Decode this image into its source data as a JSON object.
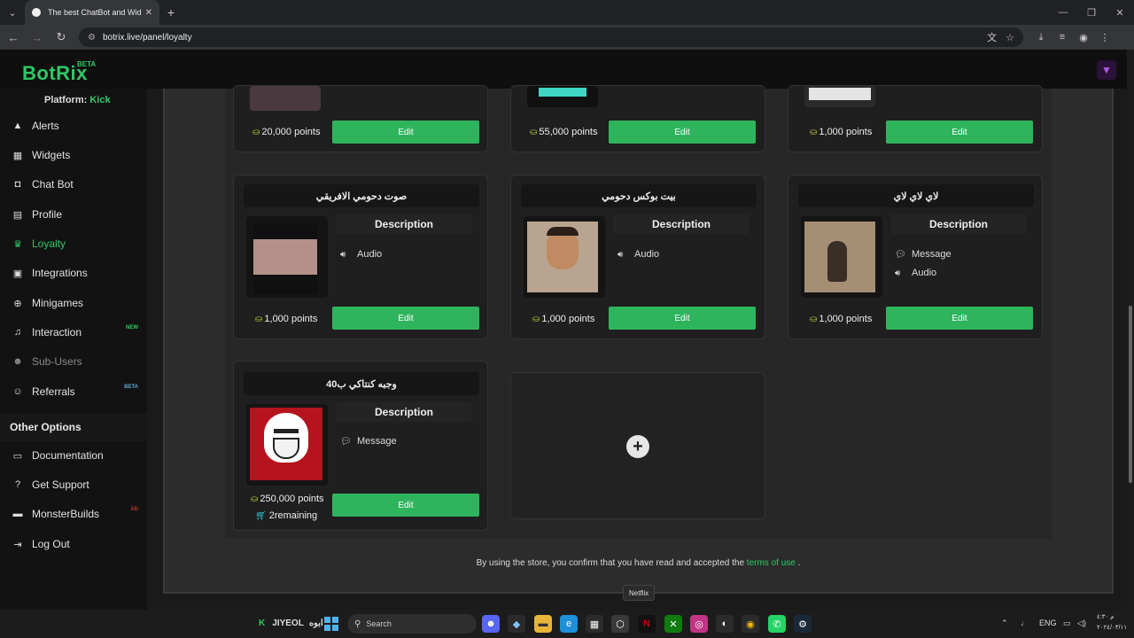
{
  "browser": {
    "tab_title": "The best ChatBot and Widgets",
    "tab_close": "✕",
    "new_tab": "+",
    "url": "botrix.live/panel/loyalty"
  },
  "app": {
    "brand": "BotRix",
    "brand_badge": "BETA",
    "platform_label": "Platform:",
    "platform_value": "Kick"
  },
  "sidebar": {
    "items": [
      {
        "label": "Alerts",
        "icon": "warning-icon"
      },
      {
        "label": "Widgets",
        "icon": "grid-icon"
      },
      {
        "label": "Chat Bot",
        "icon": "robot-icon"
      },
      {
        "label": "Profile",
        "icon": "id-card-icon"
      },
      {
        "label": "Loyalty",
        "icon": "trophy-icon"
      },
      {
        "label": "Integrations",
        "icon": "integrations-icon"
      },
      {
        "label": "Minigames",
        "icon": "gamepad-icon"
      },
      {
        "label": "Interaction",
        "icon": "music-icon",
        "badge": "NEW"
      },
      {
        "label": "Sub-Users",
        "icon": "users-icon"
      },
      {
        "label": "Referrals",
        "icon": "referrals-icon",
        "badge": "BETA"
      }
    ],
    "other_heading": "Other Options",
    "other_items": [
      {
        "label": "Documentation",
        "icon": "book-icon"
      },
      {
        "label": "Get Support",
        "icon": "question-icon"
      },
      {
        "label": "MonsterBuilds",
        "icon": "laptop-icon",
        "badge": "AD"
      },
      {
        "label": "Log Out",
        "icon": "logout-icon"
      }
    ]
  },
  "rewards_top": [
    {
      "points": "20,000 points",
      "edit": "Edit"
    },
    {
      "points": "55,000 points",
      "edit": "Edit"
    },
    {
      "points": "1,000 points",
      "edit": "Edit"
    }
  ],
  "rewards": [
    {
      "title": "صوت دحومي الافريقي",
      "desc": "Description",
      "features": [
        "Audio"
      ],
      "points": "1,000 points",
      "edit": "Edit"
    },
    {
      "title": "بيت بوكس دحومي",
      "desc": "Description",
      "features": [
        "Audio"
      ],
      "points": "1,000 points",
      "edit": "Edit"
    },
    {
      "title": "لاي لاي لاي",
      "desc": "Description",
      "features": [
        "Message",
        "Audio"
      ],
      "points": "1,000 points",
      "edit": "Edit"
    },
    {
      "title": "وجبه كنتاكي ب40",
      "desc": "Description",
      "features": [
        "Message"
      ],
      "points": "250,000 points",
      "remaining": "2remaining",
      "edit": "Edit"
    }
  ],
  "footer": {
    "text_before": "By using the store, you confirm that you have read and accepted the",
    "link": "terms of use",
    "text_after": "."
  },
  "taskbar": {
    "left_label": "JIYEOL",
    "left_label_2": "ابوه",
    "search_placeholder": "Search",
    "tooltip": "Netflix",
    "lang": "ENG",
    "time": "م ٤:٣٠",
    "date": "٢٠٢٤/٠٣/١١"
  }
}
